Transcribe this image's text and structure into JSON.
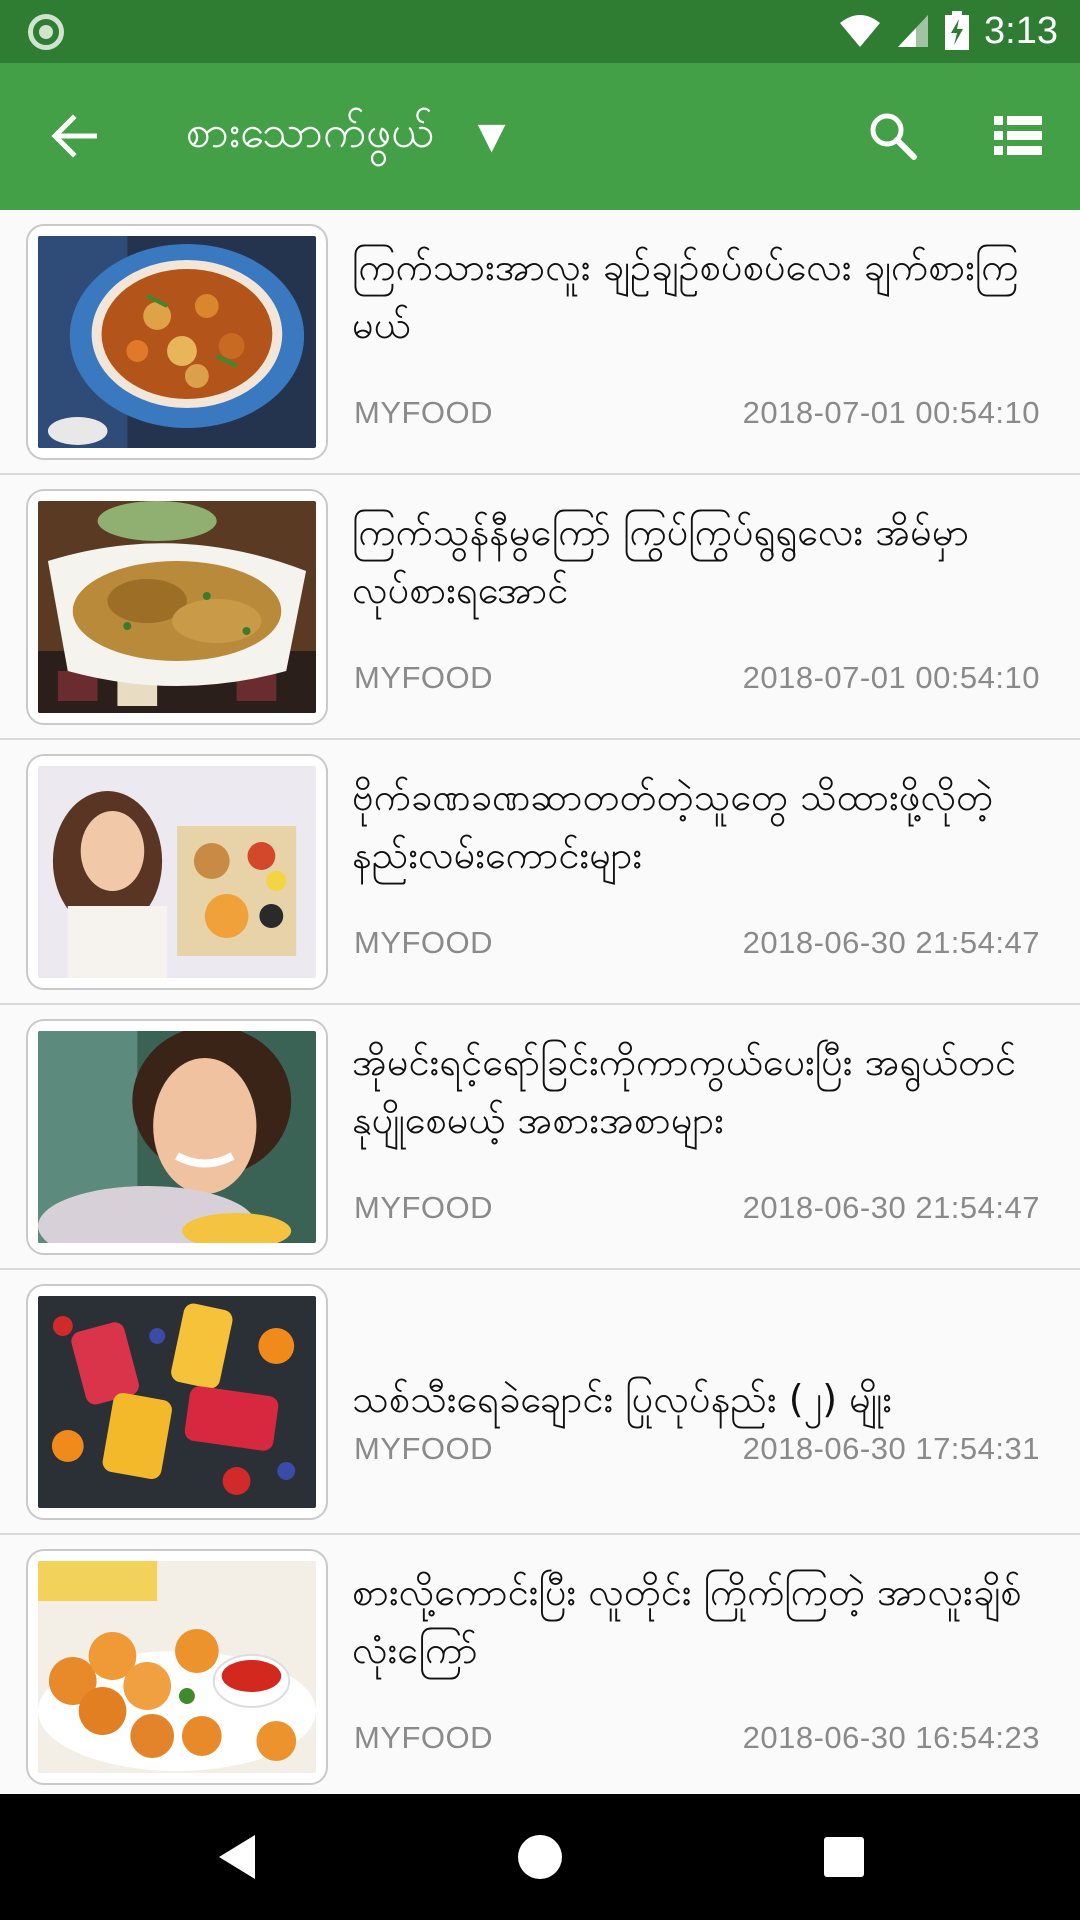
{
  "status_bar": {
    "time": "3:13",
    "icons": [
      "notification-ring-icon",
      "wifi-icon",
      "signal-icon",
      "battery-charging-icon"
    ]
  },
  "toolbar": {
    "title": "စားသောက်ဖွယ်",
    "icons": [
      "back-arrow-icon",
      "dropdown-triangle-icon",
      "search-icon",
      "list-view-icon"
    ]
  },
  "articles": [
    {
      "title": "ကြက်သားအာလူး ချဉ်ချဉ်စပ်စပ်လေး ချက်စားကြမယ်",
      "source": "MYFOOD",
      "date": "2018-07-01 00:54:10",
      "thumb": "chicken-potato-curry"
    },
    {
      "title": "ကြက်သွန်နီမွကြော် ကြွပ်ကြွပ်ရွရွလေး အိမ်မှာ လုပ်စားရအောင်",
      "source": "MYFOOD",
      "date": "2018-07-01 00:54:10",
      "thumb": "onion-fritters"
    },
    {
      "title": "ဗိုက်ခဏခဏဆာတတ်တဲ့သူတွေ သိထားဖို့လိုတဲ့နည်းလမ်းကောင်းများ",
      "source": "MYFOOD",
      "date": "2018-06-30 21:54:47",
      "thumb": "woman-breakfast-tray"
    },
    {
      "title": "အိုမင်းရင့်ရော်ခြင်းကိုကာကွယ်ပေးပြီး အရွယ်တင်နုပျိုစေမယ့် အစားအစာများ",
      "source": "MYFOOD",
      "date": "2018-06-30 21:54:47",
      "thumb": "woman-eating"
    },
    {
      "title": "သစ်သီးရေခဲချောင်း ပြုလုပ်နည်း (၂) မျိုး",
      "source": "MYFOOD",
      "date": "2018-06-30 17:54:31",
      "thumb": "fruit-popsicles"
    },
    {
      "title": "စားလို့ကောင်းပြီး လူတိုင်း ကြိုက်ကြတဲ့ အာလူးချိစ် လုံးကြော်",
      "source": "MYFOOD",
      "date": "2018-06-30 16:54:23",
      "thumb": "potato-cheese-balls"
    }
  ],
  "nav_bar": {
    "icons": [
      "back-triangle-icon",
      "home-circle-icon",
      "recents-square-icon"
    ]
  },
  "colors": {
    "status_bar": "#2e7d32",
    "toolbar": "#43a047",
    "background": "#fafafa",
    "meta_text": "#8a8a8a"
  }
}
